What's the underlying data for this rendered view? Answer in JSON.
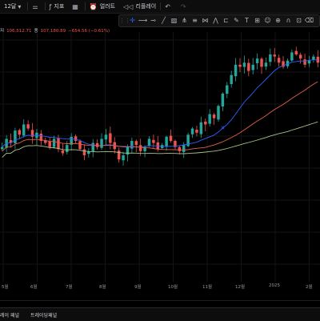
{
  "toolbar": {
    "interval": "12달",
    "indicators": "지표",
    "alert": "얼러트",
    "replay": "리플레이"
  },
  "legend": {
    "label": "저",
    "close_value": "106,512.71",
    "close_label": "종",
    "close_price": "107,180.89",
    "change": "−654.56 (−0.61%)"
  },
  "x_labels": [
    "5월",
    "6월",
    "7월",
    "8월",
    "9월",
    "10월",
    "11월",
    "12월",
    "2025",
    "2월"
  ],
  "bottom_panel": {
    "tab_1": "레이 패널",
    "tab_2": "트레이딩패널"
  },
  "colors": {
    "up": "#26a69a",
    "down": "#ef5350",
    "ma_fast": "#2962ff",
    "ma_mid": "#e0604a",
    "ma_slow": "#a6c48a",
    "marker": "#2962ff"
  },
  "chart_data": {
    "type": "candlestick",
    "series": [
      {
        "name": "price",
        "values": [
          58,
          62,
          60,
          66,
          64,
          69,
          67,
          63,
          65,
          61,
          60,
          58,
          62,
          57,
          55,
          59,
          63,
          61,
          57,
          54,
          56,
          60,
          58,
          62,
          64,
          60,
          57,
          52,
          54,
          58,
          61,
          59,
          56,
          58,
          62,
          60,
          57,
          59,
          63,
          61,
          58,
          56,
          59,
          64,
          67,
          65,
          70,
          69,
          74,
          72,
          78,
          84,
          88,
          93,
          98,
          97,
          99,
          95,
          98,
          101,
          97,
          99,
          103,
          102,
          99,
          97,
          100,
          104,
          103,
          101,
          98,
          100,
          102,
          99
        ]
      }
    ]
  }
}
